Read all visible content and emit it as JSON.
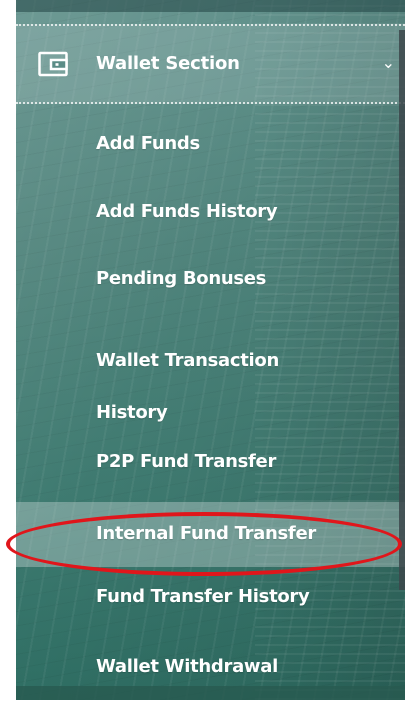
{
  "wallet_section": {
    "header_label": "Wallet Section",
    "header_icon": "wallet-icon",
    "chevron_icon": "chevron-down-icon",
    "items": [
      {
        "label": "Add Funds"
      },
      {
        "label": "Add Funds History"
      },
      {
        "label": "Pending Bonuses"
      },
      {
        "label": "Wallet Transaction History"
      },
      {
        "label": "P2P Fund Transfer"
      },
      {
        "label": "Internal Fund Transfer",
        "active": true,
        "annotated": true
      },
      {
        "label": "Fund Transfer History"
      },
      {
        "label": "Wallet Withdrawal"
      }
    ]
  },
  "colors": {
    "annotation_red": "#e0161b",
    "panel_teal": "#4f837b",
    "text": "#ffffff"
  }
}
